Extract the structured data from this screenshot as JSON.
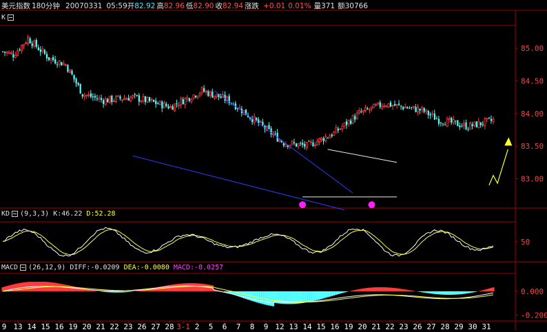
{
  "header": {
    "symbol": "美元指数",
    "period": "180分钟",
    "date": "20070331",
    "time": "05:59",
    "open_label": "开",
    "open": "82.92",
    "high_label": "高",
    "high": "82.96",
    "low_label": "低",
    "low": "82.90",
    "close_label": "收",
    "close": "82.94",
    "change_label": "涨跌",
    "change": "+0.01",
    "change_pct": "0.01%",
    "volume_label": "量",
    "volume": "371",
    "amount_label": "额",
    "amount": "30766"
  },
  "panels": {
    "price": {
      "label": "K"
    },
    "kd": {
      "name": "KD",
      "params": "(9,3,3)",
      "k_label": "K:",
      "k": "46.22",
      "d_label": "D:",
      "d": "52.28"
    },
    "macd": {
      "name": "MACD",
      "params": "(26,12,9)",
      "diff_label": "DIFF:",
      "diff": "-0.0209",
      "dea_label": "DEA:",
      "dea": "-0.0080",
      "macd_label": "MACD:",
      "macd": "-0.0257"
    }
  },
  "colors": {
    "up": "#ff3c3c",
    "down": "#54ffff",
    "k_line": "#ffffff",
    "d_line": "#ffff40",
    "trend": "#2a3cff",
    "channel": "#f0f0e0",
    "marker": "#ff20ff",
    "arrow": "#ffff30"
  },
  "chart_data": [
    {
      "type": "candlestick",
      "title": "",
      "y_ticks": [
        "85.00",
        "84.50",
        "84.00",
        "83.50",
        "83.00"
      ],
      "ylim": [
        82.55,
        85.35
      ],
      "x_ticks": [
        "9",
        "13",
        "14",
        "15",
        "16",
        "19",
        "20",
        "21",
        "22",
        "23",
        "26",
        "27",
        "28",
        "3-1",
        "2",
        "5",
        "6",
        "7",
        "8",
        "9",
        "12",
        "13",
        "14",
        "15",
        "16",
        "19",
        "20",
        "21",
        "22",
        "23",
        "26",
        "27",
        "28",
        "29",
        "30",
        "31"
      ],
      "n_bars": 235,
      "path_anchors": [
        [
          0,
          84.95
        ],
        [
          5,
          84.9
        ],
        [
          12,
          85.15
        ],
        [
          22,
          84.85
        ],
        [
          30,
          84.75
        ],
        [
          38,
          84.3
        ],
        [
          48,
          84.2
        ],
        [
          62,
          84.25
        ],
        [
          80,
          84.1
        ],
        [
          95,
          84.35
        ],
        [
          108,
          84.2
        ],
        [
          120,
          83.9
        ],
        [
          134,
          83.55
        ],
        [
          145,
          83.5
        ],
        [
          158,
          83.7
        ],
        [
          170,
          84.0
        ],
        [
          182,
          84.15
        ],
        [
          200,
          84.05
        ],
        [
          208,
          83.9
        ],
        [
          222,
          83.8
        ],
        [
          235,
          83.9
        ],
        [
          247,
          84.0
        ],
        [
          258,
          84.15
        ],
        [
          266,
          84.2
        ],
        [
          275,
          84.0
        ],
        [
          287,
          83.85
        ],
        [
          300,
          83.65
        ],
        [
          313,
          83.25
        ],
        [
          320,
          83.45
        ],
        [
          330,
          83.4
        ],
        [
          338,
          83.35
        ],
        [
          345,
          82.95
        ],
        [
          352,
          82.85
        ],
        [
          360,
          83.0
        ],
        [
          372,
          83.15
        ],
        [
          378,
          83.15
        ],
        [
          384,
          82.95
        ],
        [
          392,
          82.8
        ],
        [
          398,
          82.95
        ],
        [
          405,
          82.95
        ],
        [
          410,
          82.95
        ],
        [
          425,
          82.9
        ],
        [
          431,
          82.85
        ],
        [
          437,
          82.9
        ],
        [
          443,
          82.92
        ]
      ],
      "lines": [
        {
          "name": "",
          "from": [
            101,
            84.35
          ],
          "to": [
            167,
            82.78
          ]
        },
        {
          "name": "",
          "from": [
            62,
            83.35
          ],
          "to": [
            163,
            82.52
          ]
        },
        {
          "name": "",
          "from": [
            155,
            83.45
          ],
          "to": [
            188,
            83.25
          ]
        },
        {
          "name": "",
          "from": [
            143,
            82.72
          ],
          "to": [
            188,
            82.72
          ]
        }
      ],
      "markers": [
        [
          143,
          82.6
        ],
        [
          176,
          82.6
        ]
      ]
    },
    {
      "type": "line",
      "title": "",
      "y_ticks": [
        "50"
      ],
      "ylim": [
        0,
        100
      ],
      "series": [
        {
          "name": "K"
        },
        {
          "name": "D"
        }
      ]
    },
    {
      "type": "bar",
      "title": "",
      "y_ticks": [
        "0.000",
        "-0.200"
      ],
      "ylim": [
        -0.25,
        0.15
      ]
    }
  ]
}
